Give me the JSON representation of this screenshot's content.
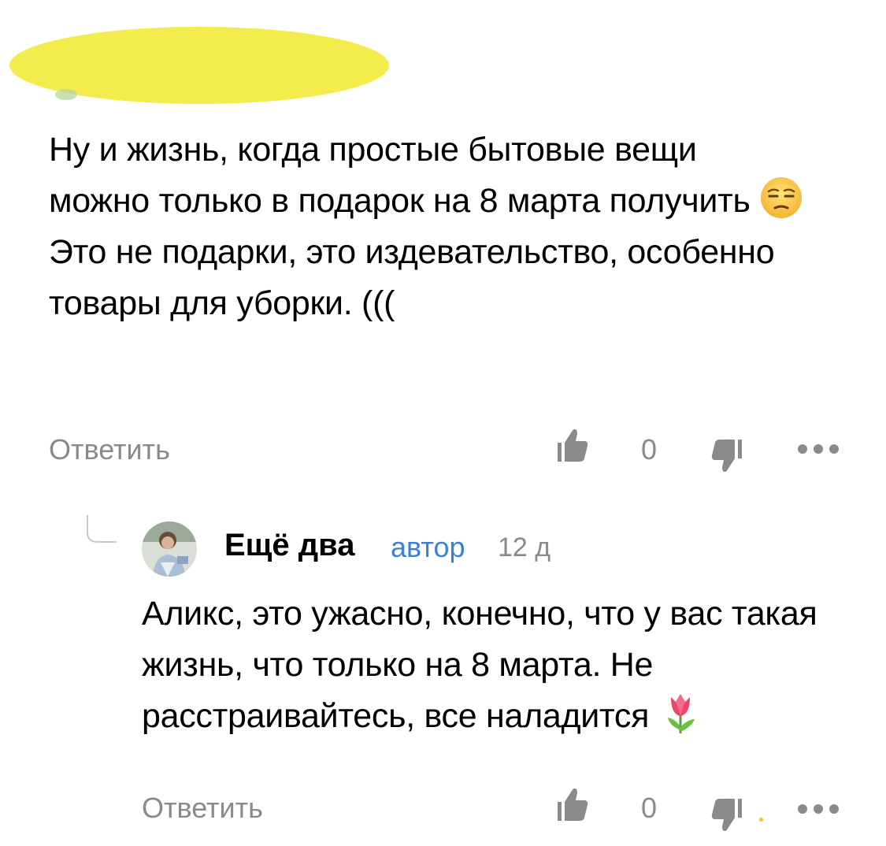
{
  "comment": {
    "text_before_emoji": "Ну и жизнь, когда простые бытовые вещи можно только в подарок на 8 марта получить",
    "emoji": "unamused-face-emoji",
    "text_after_emoji": "Это не подарки, это издевательство, особенно товары для уборки. (((",
    "reply_label": "Ответить",
    "likes": "0",
    "icons": [
      "thumbs-up-icon",
      "thumbs-down-icon",
      "more-icon"
    ]
  },
  "reply": {
    "author": "Ещё два",
    "badge": "автор",
    "time": "12 д",
    "text": "Аликс, это ужасно, конечно, что у вас такая жизнь, что только на 8 марта. Не расстраивайтесь, все наладится",
    "emoji": "tulip-emoji",
    "reply_label": "Ответить",
    "likes": "0",
    "icons": [
      "thumbs-up-icon",
      "thumbs-down-icon",
      "more-icon"
    ]
  },
  "colors": {
    "redaction": "#f2ec4c",
    "muted": "#8a8a8a",
    "author_badge": "#3b7fd6"
  }
}
